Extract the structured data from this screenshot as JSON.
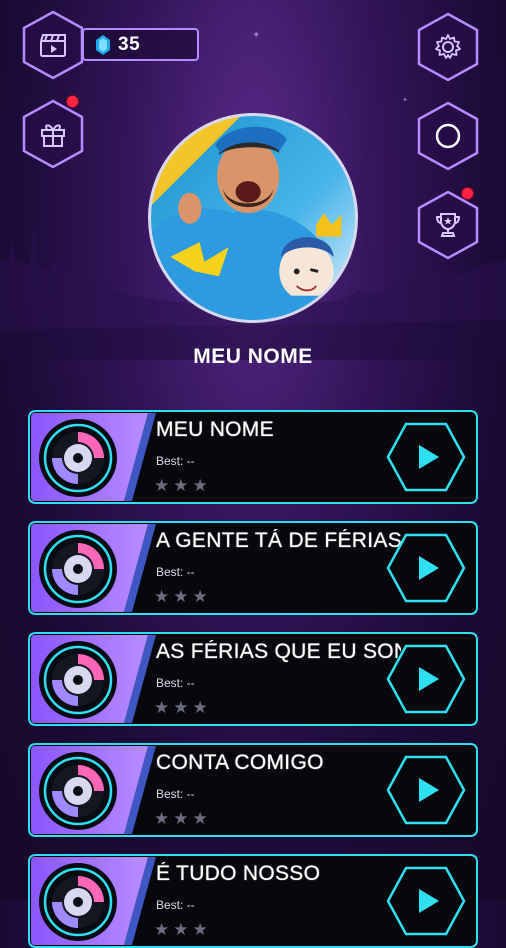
{
  "hud": {
    "gems": "35",
    "colors": {
      "accent": "#b58cff",
      "cyan": "#2fe0f0",
      "notif": "#ff2244"
    },
    "buttons": [
      {
        "name": "videos-button",
        "icon": "clapperboard-icon",
        "notification": false
      },
      {
        "name": "gift-button",
        "icon": "gift-icon",
        "notification": true
      },
      {
        "name": "settings-button",
        "icon": "gear-icon",
        "notification": false
      },
      {
        "name": "record-button",
        "icon": "circle-icon",
        "notification": false
      },
      {
        "name": "trophy-button",
        "icon": "trophy-icon",
        "notification": true
      }
    ]
  },
  "profile": {
    "name": "MEU NOME"
  },
  "songs": [
    {
      "title": "MEU NOME",
      "best": "Best: --",
      "stars": "★★★"
    },
    {
      "title": "A GENTE TÁ DE FÉRIAS",
      "best": "Best: --",
      "stars": "★★★"
    },
    {
      "title": "AS FÉRIAS QUE EU SONHEI",
      "best": "Best: --",
      "stars": "★★★"
    },
    {
      "title": "CONTA COMIGO",
      "best": "Best: --",
      "stars": "★★★"
    },
    {
      "title": "É TUDO NOSSO",
      "best": "Best: --",
      "stars": "★★★"
    }
  ]
}
